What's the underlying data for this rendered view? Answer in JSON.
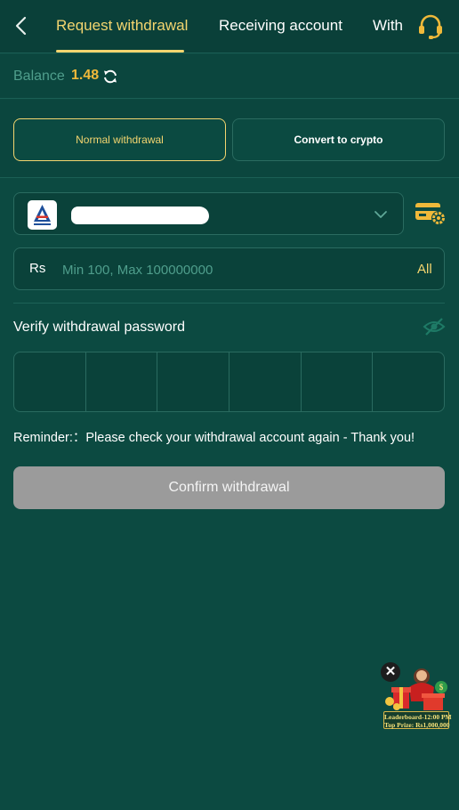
{
  "nav": {
    "tabs": [
      {
        "label": "Request withdrawal",
        "active": true
      },
      {
        "label": "Receiving account",
        "active": false
      },
      {
        "label": "With",
        "active": false
      }
    ],
    "back_icon": "chevron-left-icon",
    "support_icon": "headset-icon"
  },
  "balance": {
    "label": "Balance",
    "value": "1.48",
    "refresh_icon": "refresh-icon"
  },
  "modes": [
    {
      "label": "Normal withdrawal",
      "active": true
    },
    {
      "label": "Convert to crypto",
      "active": false
    }
  ],
  "account": {
    "bank_logo_icon": "bank-logo-icon",
    "masked": true,
    "dropdown_icon": "chevron-down-icon",
    "settings_icon": "card-settings-icon"
  },
  "amount": {
    "currency": "Rs",
    "placeholder": "Min 100, Max 100000000",
    "value": "",
    "all_label": "All"
  },
  "password": {
    "label": "Verify withdrawal password",
    "visibility_icon": "eye-off-icon",
    "digits": [
      "",
      "",
      "",
      "",
      "",
      ""
    ]
  },
  "reminder": "Reminder:：Please check your withdrawal account again - Thank you!",
  "confirm_label": "Confirm withdrawal",
  "promo": {
    "line1": "Leaderboard-12:00 PM",
    "line2": "Top Prize: Rs1,000,000",
    "close_icon": "close-icon"
  },
  "colors": {
    "background": "#0c4a41",
    "accent": "#f3d56f",
    "balance": "#f0b93a",
    "muted": "#4f9e8c",
    "button_disabled": "#9b9b9b"
  }
}
